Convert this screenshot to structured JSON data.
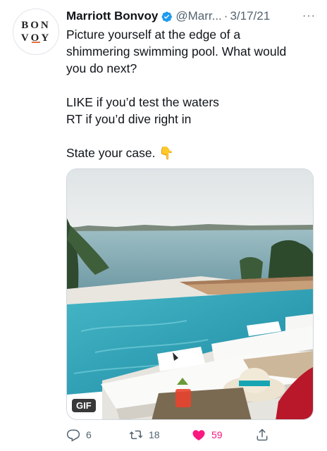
{
  "account": {
    "avatar_line1": "BON",
    "avatar_line2": "VOY",
    "name": "Marriott Bonvoy",
    "handle": "@Marr...",
    "separator": "·",
    "date": "3/17/21",
    "more_icon": "more-horizontal-icon"
  },
  "tweet": {
    "line1": "Picture yourself at the edge of a",
    "line2": "shimmering swimming pool. What would",
    "line3": "you do next?",
    "line4": "LIKE if you’d test the waters",
    "line5": "RT if you’d dive right in",
    "line6": "State your case.",
    "emoji": "👇"
  },
  "media": {
    "badge": "GIF"
  },
  "actions": {
    "replies": "6",
    "retweets": "18",
    "likes": "59"
  },
  "colors": {
    "verified": "#1d9bf0",
    "like": "#f91880",
    "secondary_text": "#536471",
    "brand_accent": "#e0723c"
  }
}
